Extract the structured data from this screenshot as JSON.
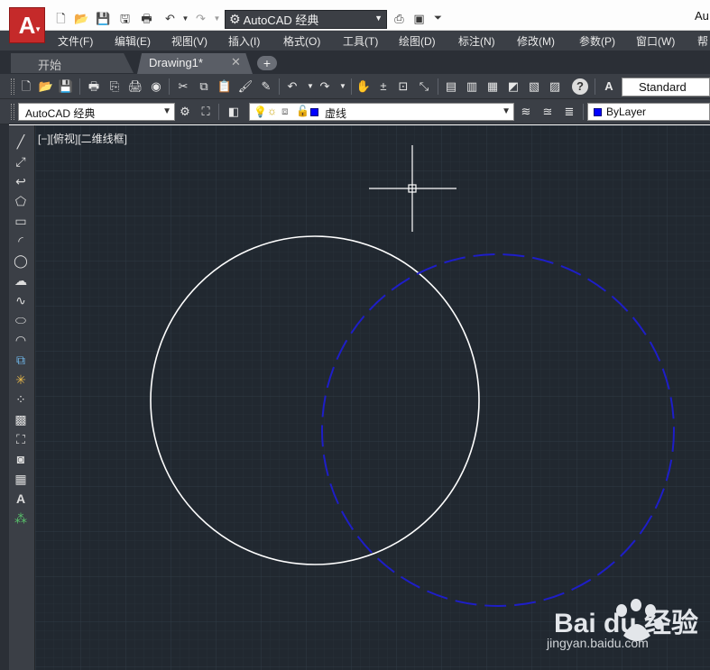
{
  "title_bar": {
    "app_letter": "A",
    "workspace": "AutoCAD 经典",
    "title_fragment": "Au"
  },
  "menu": {
    "items": [
      "文件(F)",
      "编辑(E)",
      "视图(V)",
      "插入(I)",
      "格式(O)",
      "工具(T)",
      "绘图(D)",
      "标注(N)",
      "修改(M)",
      "参数(P)",
      "窗口(W)",
      "帮"
    ]
  },
  "tabs": {
    "start": "开始",
    "drawing": "Drawing1*",
    "close_glyph": "✕",
    "add_glyph": "+"
  },
  "toolbar": {
    "text_style": "Standard",
    "workspace_combo": "AutoCAD 经典",
    "layer_name": "虚线",
    "color_combo": "ByLayer"
  },
  "viewport": {
    "label": "[−][俯视][二维线框]"
  },
  "drawing": {
    "background": "#212830",
    "solid_circle_color": "#ffffff",
    "dashed_circle_color": "#1e1ec8",
    "layer_color": "#0000ff"
  },
  "watermark": {
    "brand": "Bai du 经验",
    "url": "jingyan.baidu.com"
  },
  "icons": {
    "quick_access": [
      "new-file-icon",
      "open-folder-icon",
      "save-icon",
      "save-as-icon",
      "print-icon",
      "undo-icon",
      "redo-icon"
    ],
    "left_toolbar": [
      "line-icon",
      "construction-line-icon",
      "polyline-icon",
      "polygon-icon",
      "rectangle-icon",
      "arc-icon",
      "circle-icon",
      "revision-cloud-icon",
      "spline-icon",
      "ellipse-icon",
      "ellipse-arc-icon",
      "insert-block-icon",
      "make-block-icon",
      "point-icon",
      "hatch-icon",
      "gradient-icon",
      "region-icon",
      "table-icon",
      "multiline-text-icon",
      "add-selected-icon"
    ]
  }
}
